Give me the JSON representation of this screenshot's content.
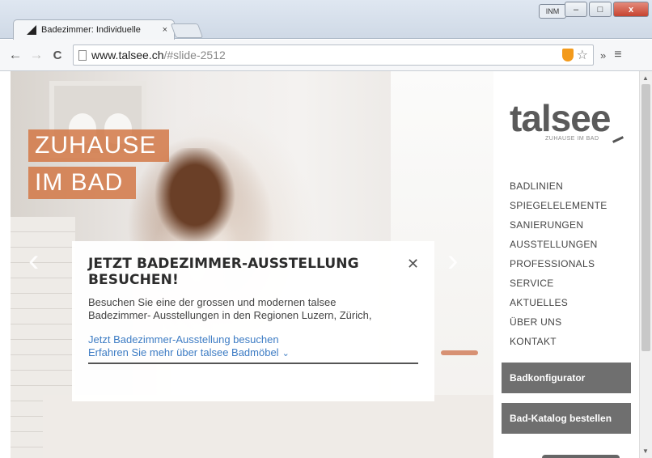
{
  "window": {
    "tab_title": "Badezimmer: Individuelle",
    "tab_close": "×",
    "profile_badge": "INM",
    "minimize": "–",
    "maximize": "□",
    "close": "x"
  },
  "toolbar": {
    "back": "←",
    "forward": "→",
    "reload": "C",
    "url_host": "www.talsee.ch",
    "url_rest": "/#slide-2512",
    "bookmark_icon": "star-icon",
    "overflow": "»",
    "menu": "≡"
  },
  "hero": {
    "slogan_line1": "ZUHAUSE",
    "slogan_line2": "IM BAD",
    "prev_arrow": "‹",
    "next_arrow": "›"
  },
  "popup": {
    "title": "JETZT BADEZIMMER-AUSSTELLUNG BESUCHEN!",
    "close": "✕",
    "text": "Besuchen Sie eine der grossen und modernen talsee Badezimmer- Ausstellungen in den Regionen Luzern, Zürich,",
    "link1": "Jetzt Badezimmer-Ausstellung besuchen",
    "link2": "Erfahren Sie mehr über talsee Badmöbel",
    "link2_chevron": "⌄"
  },
  "sidebar": {
    "logo": "talsee",
    "logo_sub": "ZUHAUSE IM BAD",
    "nav": [
      "BADLINIEN",
      "SPIEGELELEMENTE",
      "SANIERUNGEN",
      "AUSSTELLUNGEN",
      "PROFESSIONALS",
      "SERVICE",
      "AKTUELLES",
      "ÜBER UNS",
      "KONTAKT"
    ],
    "button1": "Badkonfigurator",
    "button2": "Bad-Katalog bestellen"
  },
  "scrollbar": {
    "up": "▲",
    "down": "▼"
  }
}
